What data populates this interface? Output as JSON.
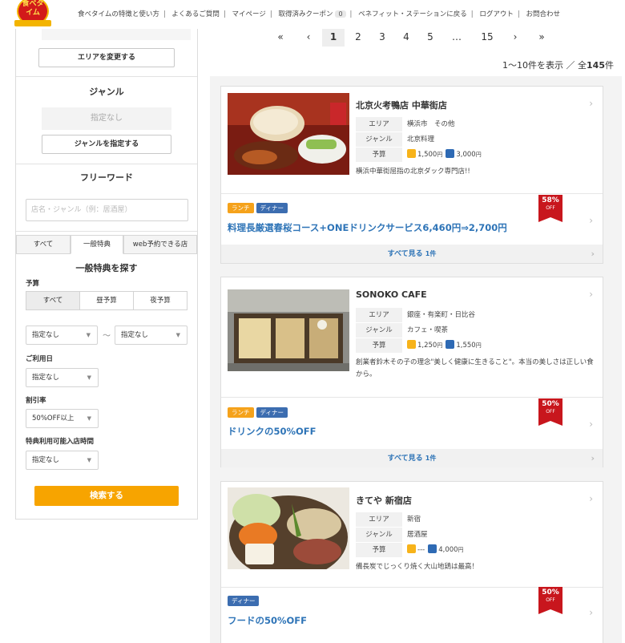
{
  "header": {
    "logo_text": "食べタイム",
    "nav": [
      "食べタイムの特徴と使い方",
      "よくあるご質問",
      "マイページ",
      "取得済みクーポン",
      "ベネフィット・ステーションに戻る",
      "ログアウト",
      "お問合わせ"
    ],
    "coupon_count": "0",
    "separator": "|"
  },
  "sidebar": {
    "area_button": "エリアを変更する",
    "genre_title": "ジャンル",
    "genre_value": "指定なし",
    "genre_button": "ジャンルを指定する",
    "freeword_title": "フリーワード",
    "freeword_placeholder": "店名・ジャンル（例：居酒屋）",
    "tabs": [
      "すべて",
      "一般特典",
      "web予約できる店"
    ],
    "section_title": "一般特典を探す",
    "budget_label": "予算",
    "budget_segments": [
      "すべて",
      "昼予算",
      "夜予算"
    ],
    "budget_min": "指定なし",
    "budget_max": "指定なし",
    "tilde": "〜",
    "date_label": "ご利用日",
    "date_value": "指定なし",
    "discount_label": "割引率",
    "discount_value": "50%OFF以上",
    "time_label": "特典利用可能入店時間",
    "time_value": "指定なし",
    "search_button": "検索する"
  },
  "pagination": {
    "first": "«",
    "prev": "‹",
    "pages": [
      "1",
      "2",
      "3",
      "4",
      "5"
    ],
    "ellipsis": "…",
    "last_page": "15",
    "next": "›",
    "last": "»",
    "current": "1"
  },
  "result_count": {
    "range": "1～10件を表示",
    "slash": "／",
    "total_label": "全",
    "total": "145",
    "unit": "件"
  },
  "labels": {
    "area": "エリア",
    "genre": "ジャンル",
    "budget": "予算",
    "lunch": "ランチ",
    "dinner": "ディナー",
    "see_all": "すべて見る",
    "off": "OFF",
    "yen": "円"
  },
  "restaurants": [
    {
      "name": "北京火考鴨店 中華街店",
      "area": "横浜市　その他",
      "genre": "北京料理",
      "lunch_budget": "1,500",
      "dinner_budget": "3,000",
      "description": "横浜中華街屈指の北京ダック専門店!!",
      "tags": [
        "lunch",
        "dinner"
      ],
      "offer": "料理長厳選春桜コース+ONEドリンクサービス6,460円⇒2,700円",
      "discount": "58%",
      "see_all_count": "1件"
    },
    {
      "name": "SONOKO CAFE",
      "area": "銀座・有楽町・日比谷",
      "genre": "カフェ・喫茶",
      "lunch_budget": "1,250",
      "dinner_budget": "1,550",
      "description": "創業者鈴木その子の理念\"美しく健康に生きること\"。本当の美しさは正しい食から。",
      "tags": [
        "lunch",
        "dinner"
      ],
      "offer": "ドリンクの50%OFF",
      "discount": "50%",
      "see_all_count": "1件"
    },
    {
      "name": "きてや 新宿店",
      "area": "新宿",
      "genre": "居酒屋",
      "lunch_budget": "---",
      "dinner_budget": "4,000",
      "description": "備長炭でじっくり焼く大山地鶏は最高！",
      "tags": [
        "dinner"
      ],
      "offer": "フードの50%OFF",
      "discount": "50%",
      "see_all_count": ""
    }
  ],
  "icons": {
    "sun": "sun-icon",
    "moon": "moon-icon",
    "chevron": "chevron-right-icon",
    "dropdown": "chevron-down-icon"
  },
  "colors": {
    "brand_red": "#c8161d",
    "accent_orange": "#f7a400",
    "link_blue": "#2e74b7",
    "dinner_blue": "#3c6db0",
    "lunch_orange": "#f5a21b"
  }
}
